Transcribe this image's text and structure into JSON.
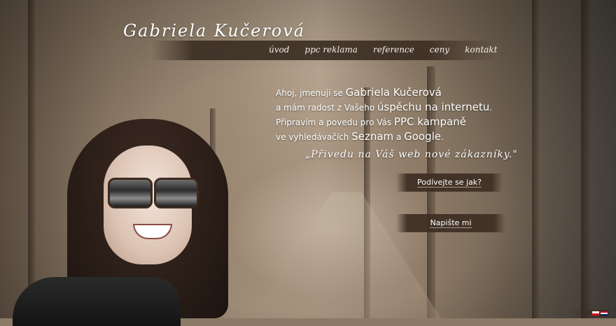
{
  "logo": {
    "text": "Gabriela Kučerová"
  },
  "nav": [
    {
      "label": "úvod"
    },
    {
      "label": "ppc reklama"
    },
    {
      "label": "reference"
    },
    {
      "label": "ceny"
    },
    {
      "label": "kontakt"
    }
  ],
  "intro": {
    "l1a": "Ahoj, jmenuji se ",
    "l1b": "Gabriela Kučerová",
    "l2a": "a mám radost z Vašeho ",
    "l2b": "úspěchu na internetu",
    "l2c": ".",
    "l3a": "Připravím a povedu pro Vás ",
    "l3b": "PPC kampaně",
    "l4a": "ve vyhledávačích ",
    "l4b": "Seznam",
    "l4c": " a ",
    "l4d": "Google",
    "l4e": "."
  },
  "quote": "„Přivedu na Váš web nové zákazníky.\"",
  "buttons": {
    "look": "Podívejte se jak?",
    "write": "Napište mi"
  },
  "colors": {
    "accent_band": "#3c2e23",
    "text": "#ffffff"
  }
}
